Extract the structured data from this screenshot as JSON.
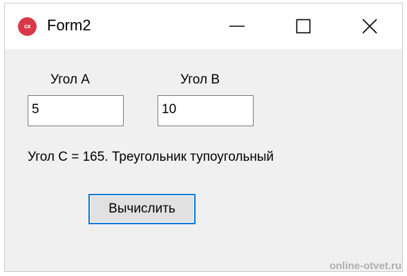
{
  "window": {
    "title": "Form2",
    "icon": "app-cx-icon",
    "icon_text": "cx"
  },
  "form": {
    "label_a": "Угол А",
    "label_b": "Угол В",
    "input_a_value": "5",
    "input_b_value": "10",
    "result_text": "Угол С = 165. Треугольник тупоугольный",
    "calculate_button_label": "Вычислить"
  },
  "watermark": "online-otvet.ru",
  "colors": {
    "accent": "#0078d7",
    "icon": "#d9374a",
    "client_background": "#f0f0f0"
  }
}
